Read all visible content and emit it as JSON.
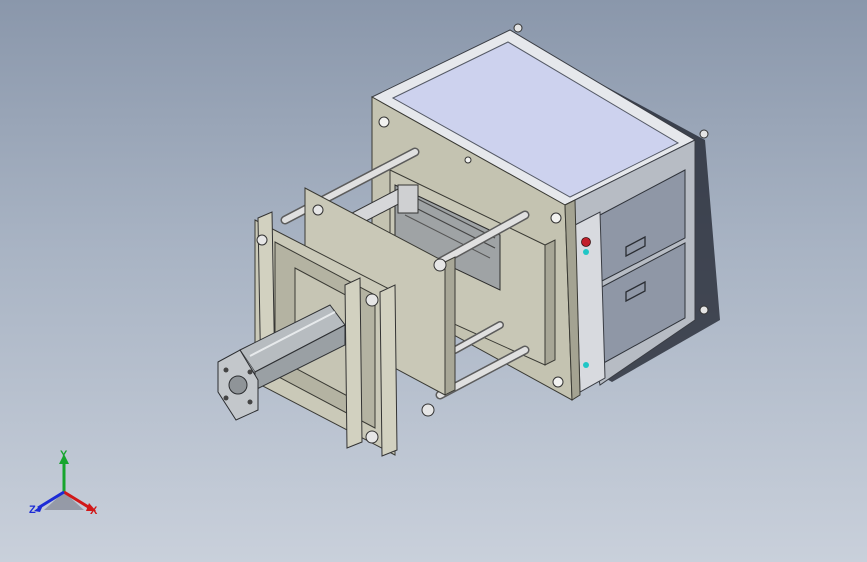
{
  "viewport": {
    "background_top": "#8a97ab",
    "background_bottom": "#c9d0db"
  },
  "model": {
    "description_icon": "mechanical-assembly-icon",
    "colors": {
      "plate_face": "#c4c3b1",
      "plate_side": "#a4a392",
      "box_panel": "#8e96a6",
      "box_top": "#c9cde6",
      "frame": "#c8cccf",
      "rod": "#dcdcdc",
      "cylinder": "#b7bcc0",
      "red_button": "#c21f2a",
      "cyan_light": "#20c6c6"
    }
  },
  "triad": {
    "x_label": "X",
    "y_label": "Y",
    "z_label": "Z",
    "x_color": "#d11818",
    "y_color": "#17a52d",
    "z_color": "#1c2bd6"
  }
}
